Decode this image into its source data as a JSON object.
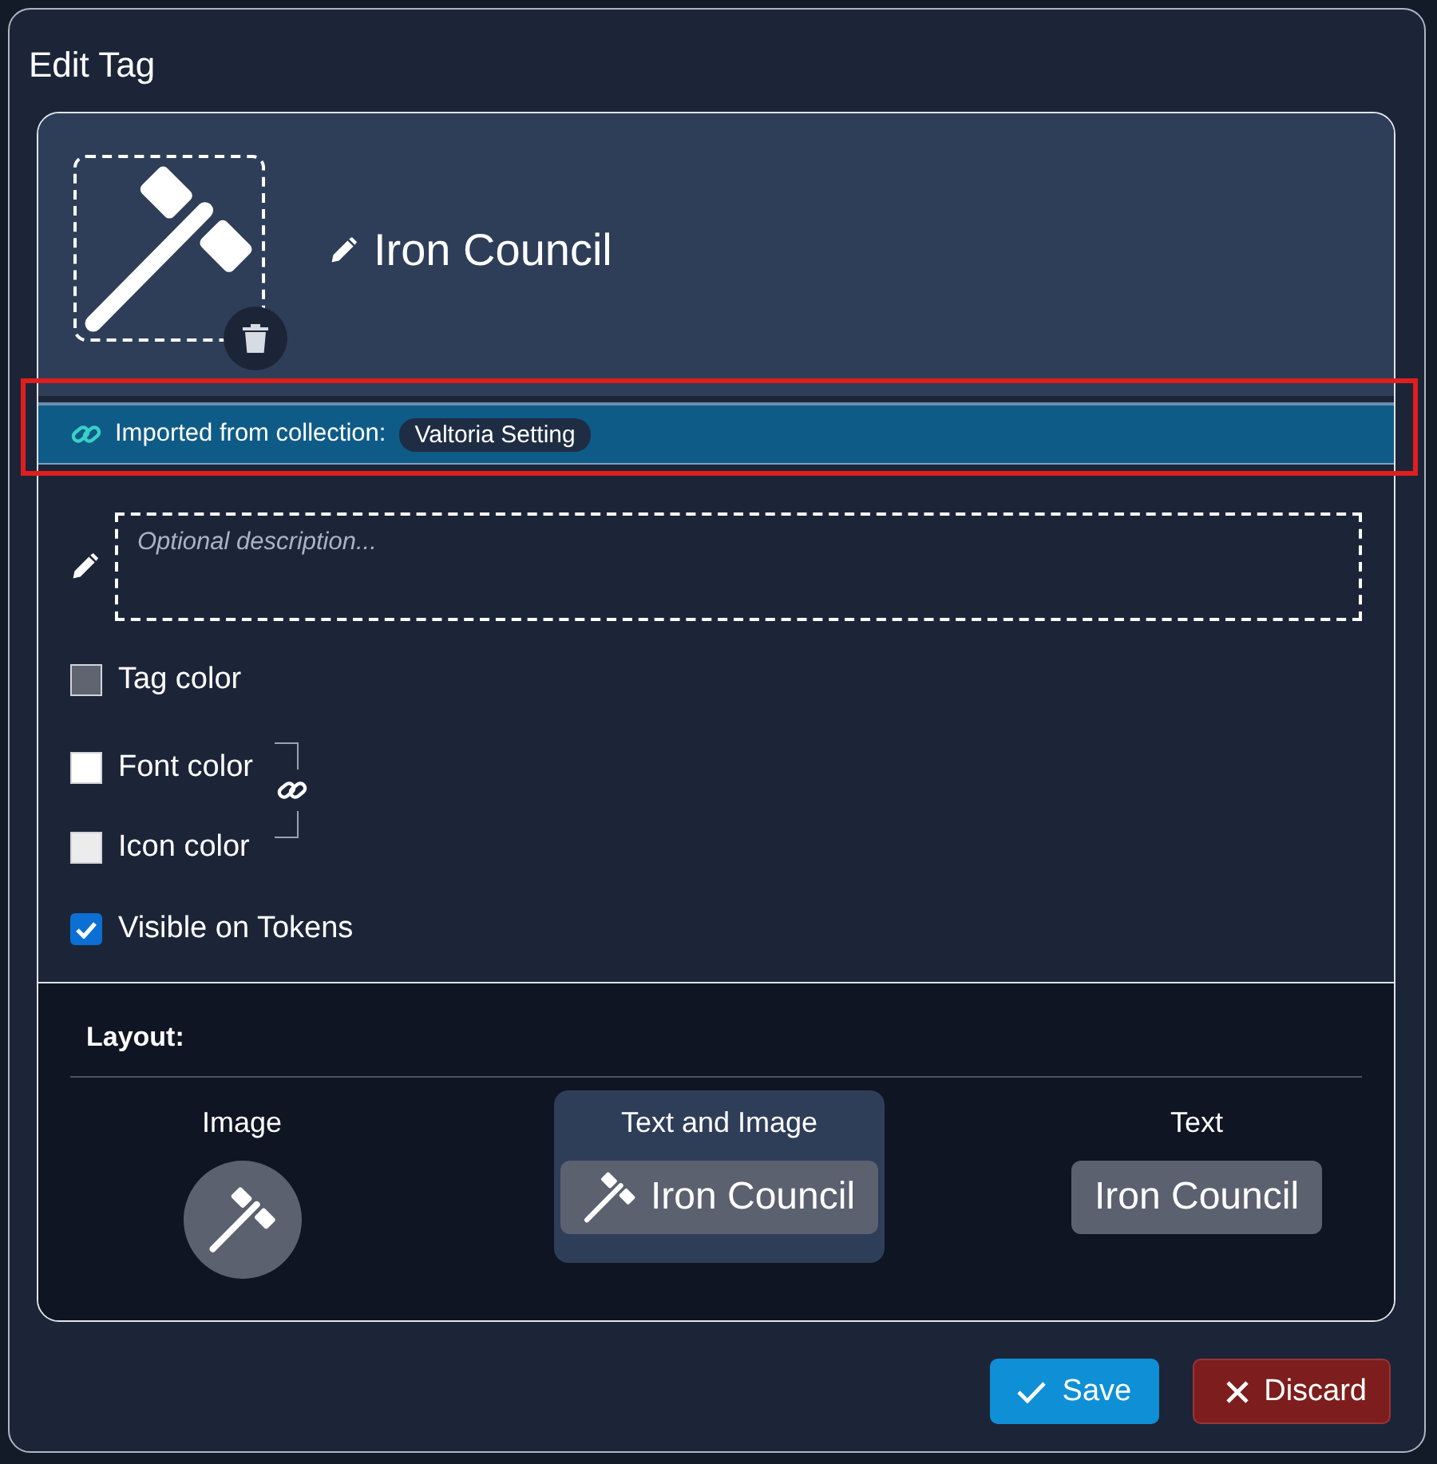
{
  "window": {
    "title": "Edit Tag"
  },
  "tag": {
    "name": "Iron Council"
  },
  "import_banner": {
    "label": "Imported from collection:",
    "collection": "Valtoria Setting",
    "highlighted": true
  },
  "description": {
    "placeholder": "Optional description..."
  },
  "colors": [
    {
      "label": "Tag color",
      "color": "#5f6470"
    },
    {
      "label": "Font color",
      "color": "#ffffff"
    },
    {
      "label": "Icon color",
      "color": "#ececec"
    }
  ],
  "color_link": {
    "linked": true
  },
  "visible_on_tokens": {
    "label": "Visible on Tokens",
    "checked": true
  },
  "layout": {
    "title": "Layout:",
    "options": [
      {
        "kind": "image",
        "label": "Image",
        "selected": false
      },
      {
        "kind": "text_and_image",
        "label": "Text and Image",
        "preview": "Iron Council",
        "selected": true
      },
      {
        "kind": "text",
        "label": "Text",
        "preview": "Iron Council",
        "selected": false
      }
    ]
  },
  "buttons": [
    {
      "kind": "save",
      "label": "Save"
    },
    {
      "kind": "discard",
      "label": "Discard"
    }
  ]
}
